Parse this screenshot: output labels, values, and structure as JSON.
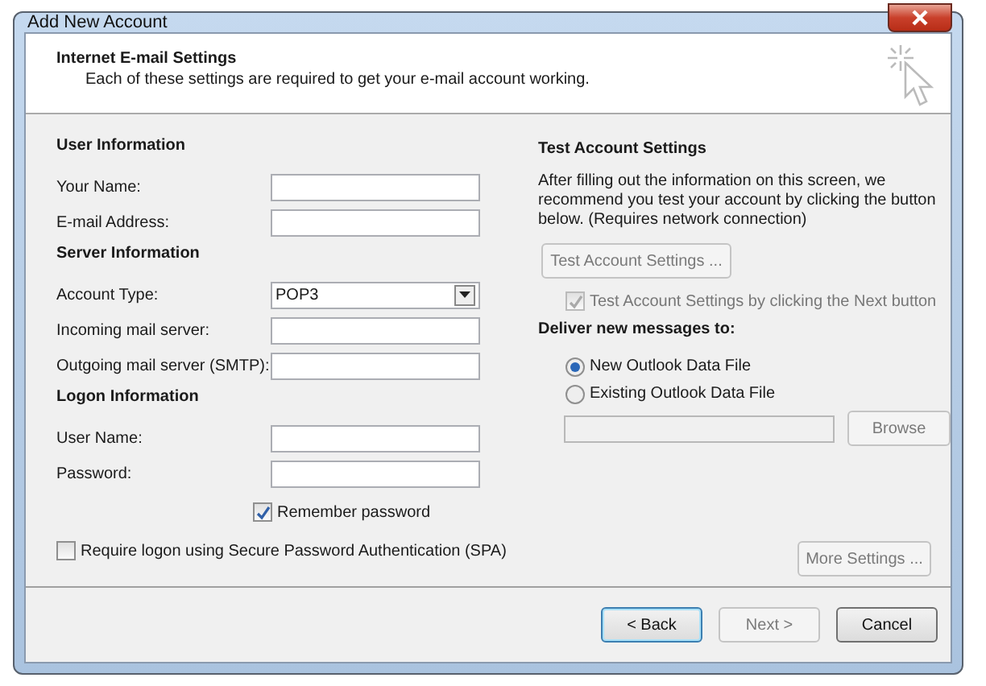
{
  "window": {
    "title": "Add New Account"
  },
  "header": {
    "title": "Internet E-mail Settings",
    "subtitle": "Each of these settings are required to get your e-mail account working."
  },
  "left_sections": [
    {
      "heading": "User Information",
      "fields": [
        {
          "label": "Your Name:",
          "kind": "text"
        },
        {
          "label": "E-mail Address:",
          "kind": "text"
        }
      ]
    },
    {
      "heading": "Server Information",
      "fields": [
        {
          "label": "Account Type:",
          "kind": "dropdown",
          "value": "POP3"
        },
        {
          "label": "Incoming mail server:",
          "kind": "text"
        },
        {
          "label": "Outgoing mail server (SMTP):",
          "kind": "text"
        }
      ]
    },
    {
      "heading": "Logon Information",
      "fields": [
        {
          "label": "User Name:",
          "kind": "text"
        },
        {
          "label": "Password:",
          "kind": "text"
        }
      ]
    }
  ],
  "remember_password": {
    "label": "Remember password",
    "checked": true
  },
  "spa": {
    "label": "Require logon using Secure Password Authentication (SPA)",
    "checked": false
  },
  "test": {
    "heading": "Test Account Settings",
    "description": "After filling out the information on this screen, we recommend you test your account by clicking the button below. (Requires network connection)",
    "button": {
      "label": "Test Account Settings ...",
      "disabled": true
    },
    "next_checkbox": {
      "label": "Test Account Settings by clicking the Next button",
      "checked": true,
      "disabled": true
    }
  },
  "deliver": {
    "heading": "Deliver new messages to:",
    "options": [
      {
        "label": "New Outlook Data File",
        "selected": true
      },
      {
        "label": "Existing Outlook Data File",
        "selected": false
      }
    ],
    "browse": {
      "label": "Browse",
      "disabled": true
    }
  },
  "more_settings": {
    "label": "More Settings ...",
    "disabled": true
  },
  "buttons": [
    {
      "label": "< Back",
      "disabled": false,
      "default": true
    },
    {
      "label": "Next >",
      "disabled": true,
      "default": false
    },
    {
      "label": "Cancel",
      "disabled": false,
      "default": false
    }
  ]
}
